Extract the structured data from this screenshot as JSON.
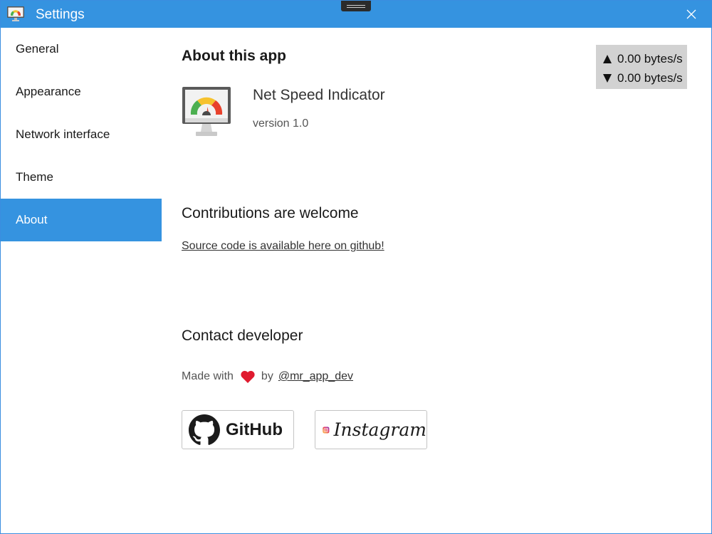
{
  "window": {
    "title": "Settings",
    "accent_color": "#3593e0",
    "icons": {
      "app": "speedometer-monitor-icon",
      "close": "close-icon",
      "drag": "drag-handle"
    }
  },
  "sidebar": {
    "items": [
      {
        "label": "General",
        "active": false
      },
      {
        "label": "Appearance",
        "active": false
      },
      {
        "label": "Network interface",
        "active": false
      },
      {
        "label": "Theme",
        "active": false
      },
      {
        "label": "About",
        "active": true
      }
    ]
  },
  "about": {
    "heading": "About this app",
    "app_name": "Net Speed Indicator",
    "version": "version 1.0",
    "logo_icon": "speedometer-monitor-icon"
  },
  "contributions": {
    "heading": "Contributions are welcome",
    "link_text": "Source code is available here on github!"
  },
  "contact": {
    "heading": "Contact developer",
    "made_with": "Made with",
    "by": "by",
    "handle": "@mr_app_dev",
    "heart_icon": "heart-icon",
    "heart_color": "#e01b2f",
    "github_label": "GitHub",
    "github_icon": "github-icon",
    "instagram_label": "Instagram",
    "instagram_icon": "instagram-icon"
  },
  "speed_indicator": {
    "upload": "0.00 bytes/s",
    "download": "0.00 bytes/s",
    "upload_icon": "up-arrow-icon",
    "download_icon": "down-arrow-icon",
    "background": "#d2d2d2"
  }
}
